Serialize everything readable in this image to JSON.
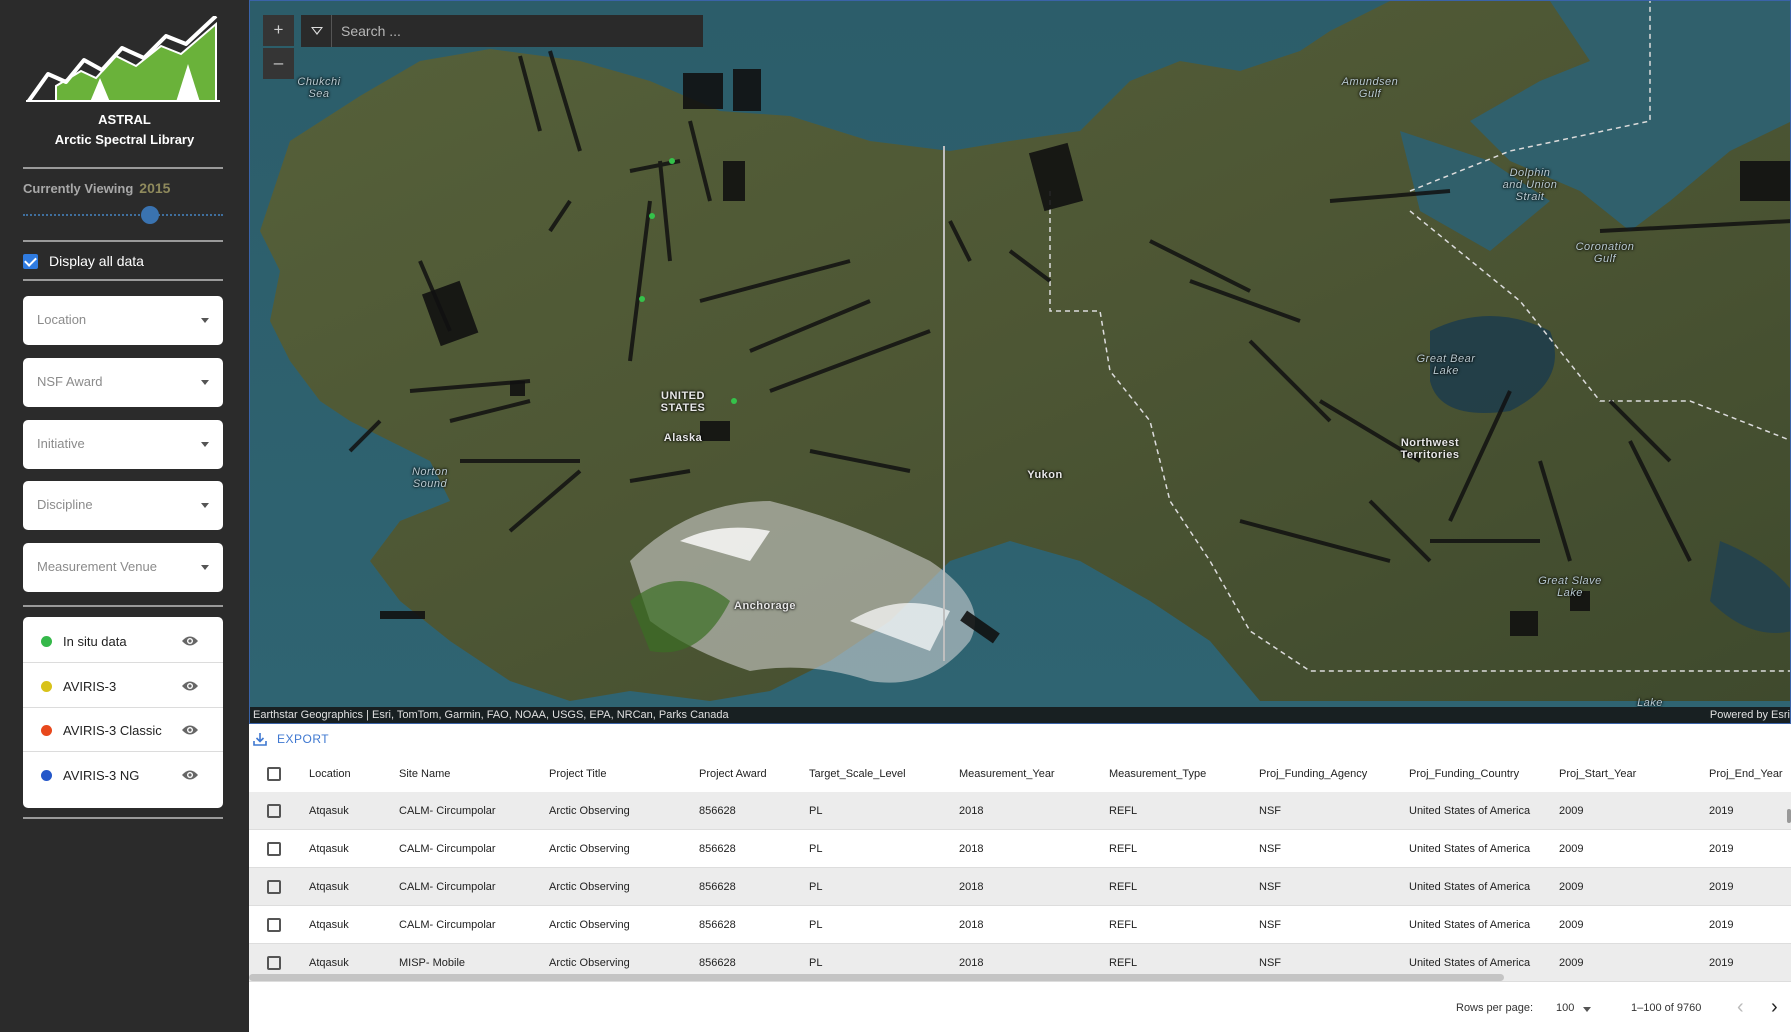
{
  "brand": {
    "name": "ASTRAL",
    "subtitle": "Arctic Spectral Library"
  },
  "sidebar": {
    "currently_viewing_label": "Currently Viewing",
    "currently_viewing_year": "2015",
    "year_slider_fraction": 0.65,
    "display_all_label": "Display all data",
    "display_all_checked": true,
    "filters": [
      {
        "label": "Location"
      },
      {
        "label": "NSF Award"
      },
      {
        "label": "Initiative"
      },
      {
        "label": "Discipline"
      },
      {
        "label": "Measurement Venue"
      }
    ],
    "layers": [
      {
        "name": "In situ data",
        "color": "#35b84a"
      },
      {
        "name": "AVIRIS-3",
        "color": "#d8c21a"
      },
      {
        "name": "AVIRIS-3 Classic",
        "color": "#e8481c"
      },
      {
        "name": "AVIRIS-3 NG",
        "color": "#2457c9"
      }
    ]
  },
  "map": {
    "zoom_in": "+",
    "zoom_out": "–",
    "search_placeholder": "Search ...",
    "labels": {
      "chukchi": "Chukchi\nSea",
      "amundsen": "Amundsen\nGulf",
      "dolphin": "Dolphin\nand Union\nStrait",
      "coronation": "Coronation\nGulf",
      "great_bear": "Great Bear\nLake",
      "united_states": "UNITED\nSTATES",
      "alaska": "Alaska",
      "norton": "Norton\nSound",
      "yukon": "Yukon",
      "nwt": "Northwest\nTerritories",
      "anchorage": "Anchorage",
      "great_slave": "Great Slave\nLake",
      "lake": "Lake"
    },
    "attribution": "Earthstar Geographics | Esri, TomTom, Garmin, FAO, NOAA, USGS, EPA, NRCan, Parks Canada",
    "powered_by": "Powered by Esri"
  },
  "table": {
    "export_label": "EXPORT",
    "columns": [
      "Location",
      "Site Name",
      "Project Title",
      "Project Award",
      "Target_Scale_Level",
      "Measurement_Year",
      "Measurement_Type",
      "Proj_Funding_Agency",
      "Proj_Funding_Country",
      "Proj_Start_Year",
      "Proj_End_Year"
    ],
    "rows": [
      [
        "Atqasuk",
        "CALM- Circumpolar",
        "Arctic Observing",
        "856628",
        "PL",
        "2018",
        "REFL",
        "NSF",
        "United States of America",
        "2009",
        "2019"
      ],
      [
        "Atqasuk",
        "CALM- Circumpolar",
        "Arctic Observing",
        "856628",
        "PL",
        "2018",
        "REFL",
        "NSF",
        "United States of America",
        "2009",
        "2019"
      ],
      [
        "Atqasuk",
        "CALM- Circumpolar",
        "Arctic Observing",
        "856628",
        "PL",
        "2018",
        "REFL",
        "NSF",
        "United States of America",
        "2009",
        "2019"
      ],
      [
        "Atqasuk",
        "CALM- Circumpolar",
        "Arctic Observing",
        "856628",
        "PL",
        "2018",
        "REFL",
        "NSF",
        "United States of America",
        "2009",
        "2019"
      ],
      [
        "Atqasuk",
        "MISP- Mobile",
        "Arctic Observing",
        "856628",
        "PL",
        "2018",
        "REFL",
        "NSF",
        "United States of America",
        "2009",
        "2019"
      ]
    ],
    "rows_per_page_label": "Rows per page:",
    "rows_per_page_value": "100",
    "range_text": "1–100 of 9760",
    "prev_icon": "‹",
    "next_icon": "›"
  }
}
